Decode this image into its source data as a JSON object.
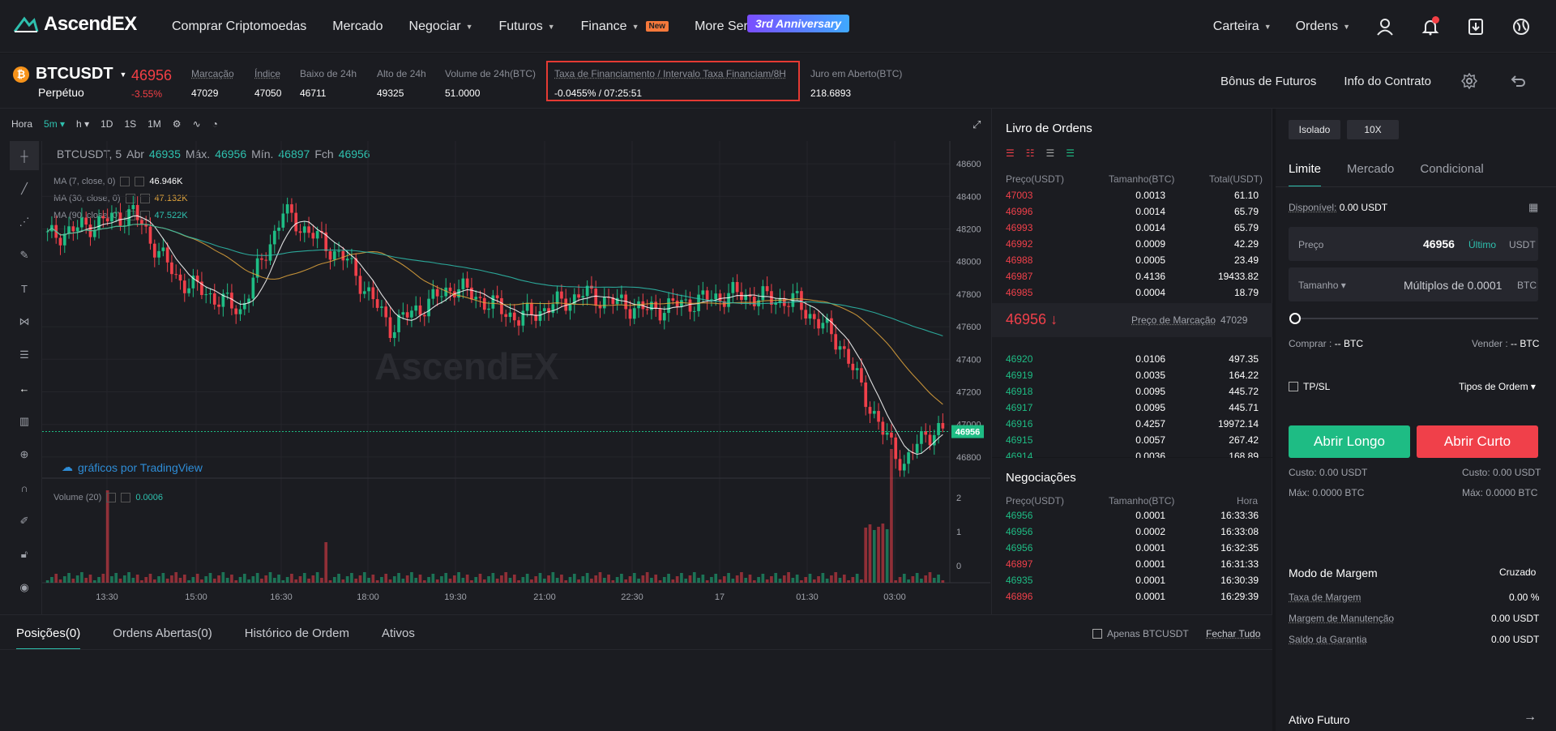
{
  "nav": {
    "logo": "AscendEX",
    "items": [
      {
        "label": "Comprar Criptomoedas",
        "caret": false
      },
      {
        "label": "Mercado",
        "caret": false
      },
      {
        "label": "Negociar",
        "caret": true
      },
      {
        "label": "Futuros",
        "caret": true
      },
      {
        "label": "Finance",
        "caret": true,
        "badge": "New"
      },
      {
        "label": "More Services",
        "caret": true
      }
    ],
    "anniversary": "3rd Anniversary",
    "right": {
      "wallet": "Carteira",
      "orders": "Ordens"
    }
  },
  "ticker": {
    "symbol": "BTCUSDT",
    "type": "Perpétuo",
    "last_price": "46956",
    "change": "-3.55%",
    "stats": [
      {
        "label": "Marcação",
        "value": "47029",
        "dotted": true
      },
      {
        "label": "Índice",
        "value": "47050",
        "dotted": true
      },
      {
        "label": "Baixo de 24h",
        "value": "46711",
        "dotted": false
      },
      {
        "label": "Alto de 24h",
        "value": "49325",
        "dotted": false
      },
      {
        "label": "Volume de 24h(BTC)",
        "value": "51.0000",
        "dotted": false
      },
      {
        "label": "Taxa de Financiamento / Intervalo Taxa Financiam/8H",
        "value": "-0.0455% / 07:25:51",
        "dotted": true
      },
      {
        "label": "Juro em Aberto(BTC)",
        "value": "218.6893",
        "dotted": false
      }
    ],
    "bonus": "Bônus de Futuros",
    "contract_info": "Info do Contrato"
  },
  "chart_toolbar": {
    "hora": "Hora",
    "interval": "5m",
    "h": "h",
    "d": "1D",
    "s": "1S",
    "m": "1M"
  },
  "chart_legend": {
    "pair": "BTCUSDT, 5",
    "open_label": "Abr",
    "open": "46935",
    "high_label": "Máx.",
    "high": "46956",
    "low_label": "Mín.",
    "low": "46897",
    "close_label": "Fch",
    "close": "46956",
    "ma": [
      {
        "label": "MA (7, close, 0)",
        "value": "46.946K",
        "color": "#ffffff"
      },
      {
        "label": "MA (30, close, 0)",
        "value": "47.132K",
        "color": "#e0a43c"
      },
      {
        "label": "MA (90, close, 0)",
        "value": "47.522K",
        "color": "#2ec0ae"
      }
    ],
    "volume_label": "Volume (20)",
    "volume_value": "0.0006",
    "tradingview": "gráficos por TradingView",
    "watermark": "AscendEX"
  },
  "chart_data": {
    "type": "candlestick",
    "y_ticks": [
      "48600",
      "48400",
      "48200",
      "48000",
      "47800",
      "47600",
      "47400",
      "47200",
      "47000",
      "46800"
    ],
    "ylim": [
      46700,
      48700
    ],
    "x_ticks": [
      "13:30",
      "15:00",
      "16:30",
      "18:00",
      "19:30",
      "21:00",
      "22:30",
      "17",
      "01:30",
      "03:00"
    ],
    "current_price": "46956",
    "volume_ticks": [
      "2",
      "1",
      "0"
    ]
  },
  "orderbook": {
    "title": "Livro de Ordens",
    "headers": [
      "Preço(USDT)",
      "Tamanho(BTC)",
      "Total(USDT)"
    ],
    "asks": [
      [
        "47003",
        "0.0013",
        "61.10"
      ],
      [
        "46996",
        "0.0014",
        "65.79"
      ],
      [
        "46993",
        "0.0014",
        "65.79"
      ],
      [
        "46992",
        "0.0009",
        "42.29"
      ],
      [
        "46988",
        "0.0005",
        "23.49"
      ],
      [
        "46987",
        "0.4136",
        "19433.82"
      ],
      [
        "46985",
        "0.0004",
        "18.79"
      ]
    ],
    "mid_price": "46956",
    "mark_label": "Preço de Marcação",
    "mark_price": "47029",
    "bids": [
      [
        "46920",
        "0.0106",
        "497.35"
      ],
      [
        "46919",
        "0.0035",
        "164.22"
      ],
      [
        "46918",
        "0.0095",
        "445.72"
      ],
      [
        "46917",
        "0.0095",
        "445.71"
      ],
      [
        "46916",
        "0.4257",
        "19972.14"
      ],
      [
        "46915",
        "0.0057",
        "267.42"
      ],
      [
        "46914",
        "0.0036",
        "168.89"
      ]
    ]
  },
  "trades": {
    "title": "Negociações",
    "headers": [
      "Preço(USDT)",
      "Tamanho(BTC)",
      "Hora"
    ],
    "rows": [
      {
        "p": "46956",
        "s": "0.0001",
        "t": "16:33:36",
        "side": "buy"
      },
      {
        "p": "46956",
        "s": "0.0002",
        "t": "16:33:08",
        "side": "buy"
      },
      {
        "p": "46956",
        "s": "0.0001",
        "t": "16:32:35",
        "side": "buy"
      },
      {
        "p": "46897",
        "s": "0.0001",
        "t": "16:31:33",
        "side": "sell"
      },
      {
        "p": "46935",
        "s": "0.0001",
        "t": "16:30:39",
        "side": "buy"
      },
      {
        "p": "46896",
        "s": "0.0001",
        "t": "16:29:39",
        "side": "sell"
      }
    ]
  },
  "panel": {
    "isolated": "Isolado",
    "leverage": "10X",
    "tabs": [
      "Limite",
      "Mercado",
      "Condicional"
    ],
    "available_label": "Disponível:",
    "available": "0.00 USDT",
    "price_label": "Preço",
    "price_value": "46956",
    "price_last": "Último",
    "price_unit": "USDT",
    "size_label": "Tamanho",
    "size_placeholder": "Múltiplos de 0.0001",
    "size_unit": "BTC",
    "buy_label": "Comprar :",
    "buy_value": "-- BTC",
    "sell_label": "Vender :",
    "sell_value": "-- BTC",
    "tpsl": "TP/SL",
    "order_types": "Tipos de Ordem",
    "open_long": "Abrir Longo",
    "open_short": "Abrir Curto",
    "cost_long": "Custo: 0.00 USDT",
    "cost_short": "Custo: 0.00 USDT",
    "max_long": "Máx: 0.0000 BTC",
    "max_short": "Máx: 0.0000 BTC",
    "margin_mode_label": "Modo de Margem",
    "margin_mode": "Cruzado",
    "margin_rate_label": "Taxa de Margem",
    "margin_rate": "0.00 %",
    "maint_label": "Margem de Manutenção",
    "maint": "0.00 USDT",
    "balance_label": "Saldo da Garantia",
    "balance": "0.00 USDT",
    "futures_asset": "Ativo Futuro"
  },
  "bottom": {
    "tabs": [
      "Posições(0)",
      "Ordens Abertas(0)",
      "Histórico de Ordem",
      "Ativos"
    ],
    "only_symbol": "Apenas BTCUSDT",
    "close_all": "Fechar Tudo"
  },
  "colors": {
    "green": "#1ebc84",
    "red": "#f0404a",
    "teal": "#2ec0ae",
    "bg": "#1b1c21"
  }
}
